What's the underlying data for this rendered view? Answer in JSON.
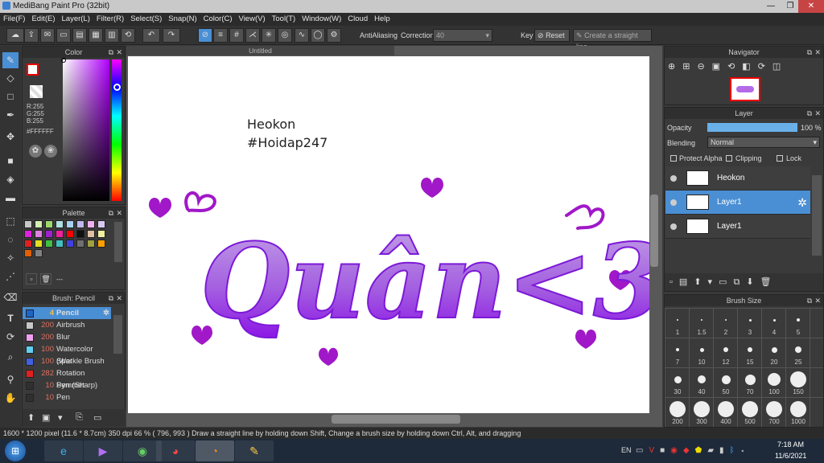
{
  "window": {
    "title": "MediBang Paint Pro (32bit)",
    "minimize": "—",
    "maximize": "❐",
    "close": "✕"
  },
  "menu": [
    "File(F)",
    "Edit(E)",
    "Layer(L)",
    "Filter(R)",
    "Select(S)",
    "Snap(N)",
    "Color(C)",
    "View(V)",
    "Tool(T)",
    "Window(W)",
    "Cloud",
    "Help"
  ],
  "toolbar": {
    "antialiasing_label": "AntiAliasing",
    "correction_label": "Correction",
    "correction_value": "40",
    "key_label": "Key",
    "reset_label": "Reset",
    "straight_line_label": "Create a straight line"
  },
  "color_panel": {
    "title": "Color",
    "r": "R:255",
    "g": "G:255",
    "b": "B:255",
    "hex": "#FFFFFF"
  },
  "palette_panel": {
    "title": "Palette",
    "more": "---",
    "swatches": [
      "#c8c8c8",
      "#d4f0b0",
      "#9ed86a",
      "#b0e0e0",
      "#a8d0f0",
      "#c0b8f0",
      "#f0b0f0",
      "#d8c8f0",
      "#e020e0",
      "#e080e0",
      "#a020d0",
      "#f020a0",
      "#ff0000",
      "#101010",
      "#e0c0a0",
      "#f0f0a0",
      "#e02020",
      "#e0e020",
      "#40c040",
      "#40c0c0",
      "#4040e0",
      "#707070",
      "#a0a040",
      "#ffa000",
      "#e06000",
      "#808080"
    ]
  },
  "brush_panel": {
    "title": "Brush: Pencil",
    "items": [
      {
        "size": "4",
        "name": "Pencil",
        "color": "#1e64c8"
      },
      {
        "size": "200",
        "name": "Airbrush",
        "color": "#c8c8c8"
      },
      {
        "size": "200",
        "name": "Blur",
        "color": "#f0a0f0"
      },
      {
        "size": "100",
        "name": "Watercolor (Wet",
        "color": "#60d0f0"
      },
      {
        "size": "100",
        "name": "Sparkle Brush",
        "color": "#4060e0"
      },
      {
        "size": "282",
        "name": "Rotation Symmet",
        "color": "#e02020"
      },
      {
        "size": "10",
        "name": "Pen (Sharp)",
        "color": "#303030"
      },
      {
        "size": "10",
        "name": "Pen",
        "color": "#303030"
      }
    ]
  },
  "canvas": {
    "tab_title": "Untitled",
    "text_line1": "Heokon",
    "text_line2": "#Hoidap247",
    "art_text": "Quân<3"
  },
  "navigator": {
    "title": "Navigator"
  },
  "layer_panel": {
    "title": "Layer",
    "opacity_label": "Opacity",
    "opacity_value": "100 %",
    "opacity_level": 1.0,
    "blending_label": "Blending",
    "blending_value": "Normal",
    "protect_alpha": "Protect Alpha",
    "clipping": "Clipping",
    "lock": "Lock",
    "layers": [
      {
        "name": "Heokon",
        "selected": false
      },
      {
        "name": "Layer1",
        "selected": true
      },
      {
        "name": "Layer1",
        "selected": false
      }
    ]
  },
  "brush_size_panel": {
    "title": "Brush Size",
    "sizes": [
      "1",
      "1.5",
      "2",
      "3",
      "4",
      "5",
      "7",
      "10",
      "12",
      "15",
      "20",
      "25",
      "30",
      "40",
      "50",
      "70",
      "100",
      "150",
      "200",
      "300",
      "400",
      "500",
      "700",
      "1000"
    ]
  },
  "status": {
    "dimensions": "1600 * 1200 pixel",
    "physical": "(11.6 * 8.7cm)",
    "dpi": "350 dpi",
    "zoom": "66 %",
    "coords": "( 796, 993 )",
    "hint": "Draw a straight line by holding down Shift, Change a brush size by holding down Ctrl, Alt, and dragging"
  },
  "taskbar": {
    "lang": "EN",
    "time": "7:18 AM",
    "date": "11/6/2021"
  }
}
